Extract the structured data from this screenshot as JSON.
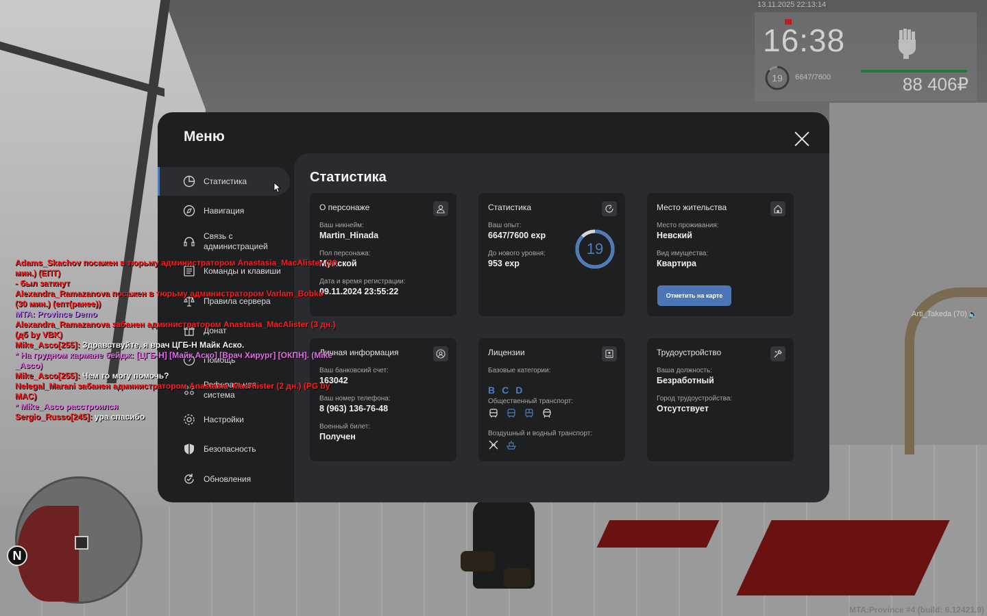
{
  "hud": {
    "datetime": "13.11.2025 22:13:14",
    "time": "16:38",
    "level": "19",
    "exp": "6647/7600",
    "exp_fraction": 0.875,
    "money": "88 406₽"
  },
  "player_tag": {
    "name": "Arti_Takeda (70)"
  },
  "build": "MTA:Province #4 (build: 6.12421.9)",
  "minimap": {
    "north": "N"
  },
  "menu": {
    "title": "Меню",
    "sidebar": [
      {
        "label": "Статистика",
        "icon": "pie-chart-icon",
        "active": true
      },
      {
        "label": "Навигация",
        "icon": "compass-icon"
      },
      {
        "label": "Связь с администрацией",
        "icon": "headset-icon"
      },
      {
        "label": "Команды и клавиши",
        "icon": "keyboard-icon"
      },
      {
        "label": "Правила сервера",
        "icon": "scales-icon"
      },
      {
        "label": "Донат",
        "icon": "gift-icon"
      },
      {
        "label": "Помощь",
        "icon": "help-icon"
      },
      {
        "label": "Реферальная система",
        "icon": "referral-icon"
      },
      {
        "label": "Настройки",
        "icon": "gear-icon"
      },
      {
        "label": "Безопасность",
        "icon": "shield-icon"
      },
      {
        "label": "Обновления",
        "icon": "refresh-icon"
      }
    ],
    "content_title": "Статистика",
    "cards": {
      "character": {
        "title": "О персонаже",
        "nick_label": "Ваш никнейм:",
        "nick": "Martin_Hinada",
        "gender_label": "Пол персонажа:",
        "gender": "Мужской",
        "reg_label": "Дата и время регистрации:",
        "reg": "09.11.2024 23:55:22"
      },
      "stats": {
        "title": "Статистика",
        "exp_label": "Ваш опыт:",
        "exp": "6647/7600 exp",
        "next_label": "До нового уровня:",
        "next": "953 exp",
        "level": "19",
        "progress": 0.875
      },
      "residence": {
        "title": "Место жительства",
        "place_label": "Место проживания:",
        "place": "Невский",
        "prop_label": "Вид имущества:",
        "prop": "Квартира",
        "button": "Отметить на карте"
      },
      "personal": {
        "title": "Личная информация",
        "bank_label": "Ваш банковский счет:",
        "bank": "163042",
        "phone_label": "Ваш номер телефона:",
        "phone": "8 (963) 136-76-48",
        "military_label": "Военный билет:",
        "military": "Получен"
      },
      "licenses": {
        "title": "Лицензии",
        "base_label": "Базовые категории:",
        "base": [
          "B",
          "C",
          "D"
        ],
        "public_label": "Общественный транспорт:",
        "air_label": "Воздушный и водный транспорт:"
      },
      "job": {
        "title": "Трудоустройство",
        "position_label": "Ваша должность:",
        "position": "Безработный",
        "city_label": "Город трудоустройства:",
        "city": "Отсутствует"
      }
    }
  },
  "chat": [
    {
      "color": "red",
      "text": "Adams_Skachov посажен в тюрьму администратором Anastasia_MacAlister (30 мин.) (ЕПТ)"
    },
    {
      "color": "red",
      "text": "- был заткнут"
    },
    {
      "color": "red",
      "text": "Alexandra_Ramazanova посажен в тюрьму администратором Varlam_Bobko (30 мин.) (епт(ранее))"
    },
    {
      "color": "purple",
      "text": "MTA: Province Demo"
    },
    {
      "color": "red",
      "text": "Alexandra_Ramazanova забанен администратором Anastasia_MacAlister (3 дн.) (дб by VBK)"
    },
    {
      "color": "mixed",
      "name": "Mike_Asco[255]:",
      "text": " Здравствуйте, я врач ЦГБ-Н Майк Аско."
    },
    {
      "color": "pink",
      "text": "* На грудном кармане бейдж: [ЦГБ-Н] [Майк Аско] [Врач Хирург] [ОКПН]. (Mike _Asco)"
    },
    {
      "color": "mixed",
      "name": "Mike_Asco[255]:",
      "text": " Чем то могу помочь?"
    },
    {
      "color": "red",
      "text": "Nelegal_Marani забанен администратором Anastasia_MacAlister (2 дн.) (PG by MAC)"
    },
    {
      "color": "pink",
      "text": "* Mike_Asco расстроился"
    },
    {
      "color": "mixed",
      "name": "Sergio_Russo[245]:",
      "text": " ура спасибо"
    }
  ]
}
